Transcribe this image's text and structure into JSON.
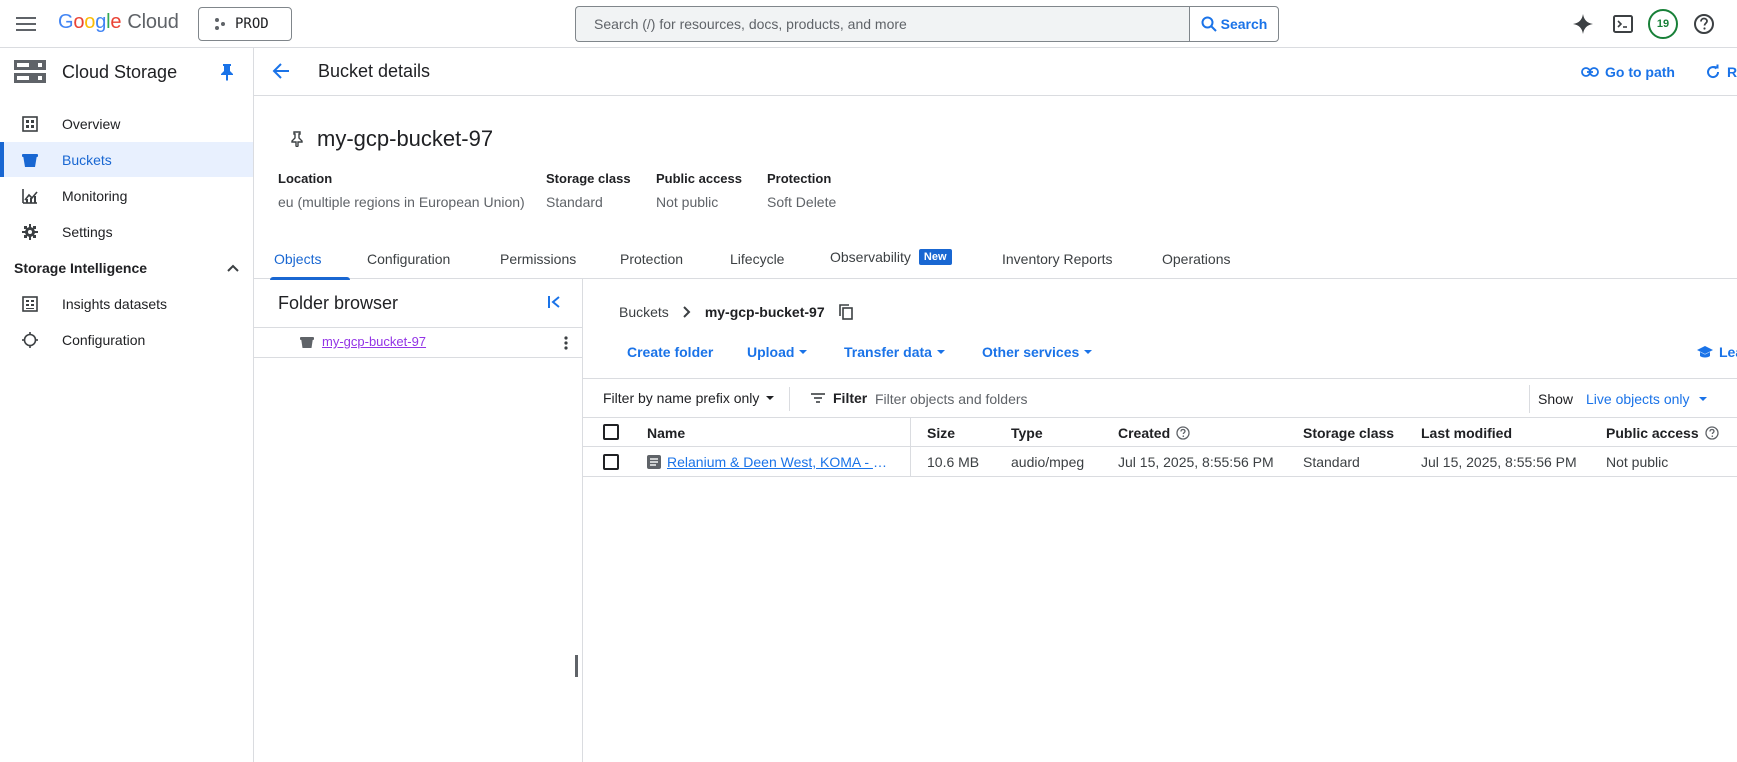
{
  "topbar": {
    "logo": {
      "g1": "G",
      "g2": "o",
      "g3": "o",
      "g4": "g",
      "g5": "l",
      "g6": "e",
      "cloud": "Cloud"
    },
    "project": "PROD",
    "search_placeholder": "Search (/) for resources, docs, products, and more",
    "search_button": "Search",
    "avatar_text": "19"
  },
  "sidebar": {
    "title": "Cloud Storage",
    "items": [
      {
        "label": "Overview",
        "icon": "dashboard-icon"
      },
      {
        "label": "Buckets",
        "icon": "bucket-icon",
        "active": true
      },
      {
        "label": "Monitoring",
        "icon": "chart-icon"
      },
      {
        "label": "Settings",
        "icon": "gear-icon"
      }
    ],
    "section": "Storage Intelligence",
    "section_items": [
      {
        "label": "Insights datasets",
        "icon": "dataset-icon"
      },
      {
        "label": "Configuration",
        "icon": "config-icon"
      }
    ]
  },
  "header": {
    "title": "Bucket details",
    "go_to_path": "Go to path",
    "refresh": "R"
  },
  "bucket": {
    "name": "my-gcp-bucket-97",
    "meta": [
      {
        "key": "Location",
        "value": "eu (multiple regions in European Union)"
      },
      {
        "key": "Storage class",
        "value": "Standard"
      },
      {
        "key": "Public access",
        "value": "Not public"
      },
      {
        "key": "Protection",
        "value": "Soft Delete"
      }
    ]
  },
  "tabs": {
    "objects": "Objects",
    "configuration": "Configuration",
    "permissions": "Permissions",
    "protection": "Protection",
    "lifecycle": "Lifecycle",
    "observability": "Observability",
    "new_badge": "New",
    "inventory": "Inventory Reports",
    "operations": "Operations"
  },
  "folder_browser": {
    "title": "Folder browser",
    "root": "my-gcp-bucket-97"
  },
  "breadcrumb": {
    "buckets": "Buckets",
    "current": "my-gcp-bucket-97"
  },
  "actions": {
    "create_folder": "Create folder",
    "upload": "Upload",
    "transfer": "Transfer data",
    "other": "Other services",
    "learn": "Lea"
  },
  "filter": {
    "prefix": "Filter by name prefix only",
    "filter_label": "Filter",
    "placeholder": "Filter objects and folders",
    "show_label": "Show",
    "show_value": "Live objects only"
  },
  "table": {
    "headers": {
      "name": "Name",
      "size": "Size",
      "type": "Type",
      "created": "Created",
      "storage_class": "Storage class",
      "last_modified": "Last modified",
      "public_access": "Public access"
    },
    "rows": [
      {
        "name": "Relanium & Deen West, KOMA - Cl...",
        "size": "10.6 MB",
        "type": "audio/mpeg",
        "created": "Jul 15, 2025, 8:55:56 PM",
        "storage_class": "Standard",
        "last_modified": "Jul 15, 2025, 8:55:56 PM",
        "public_access": "Not public"
      }
    ]
  },
  "colors": {
    "accent": "#1a73e8",
    "active_bg": "#e8f0fe",
    "visited_link": "#9334e6",
    "avatar": "#188038"
  }
}
